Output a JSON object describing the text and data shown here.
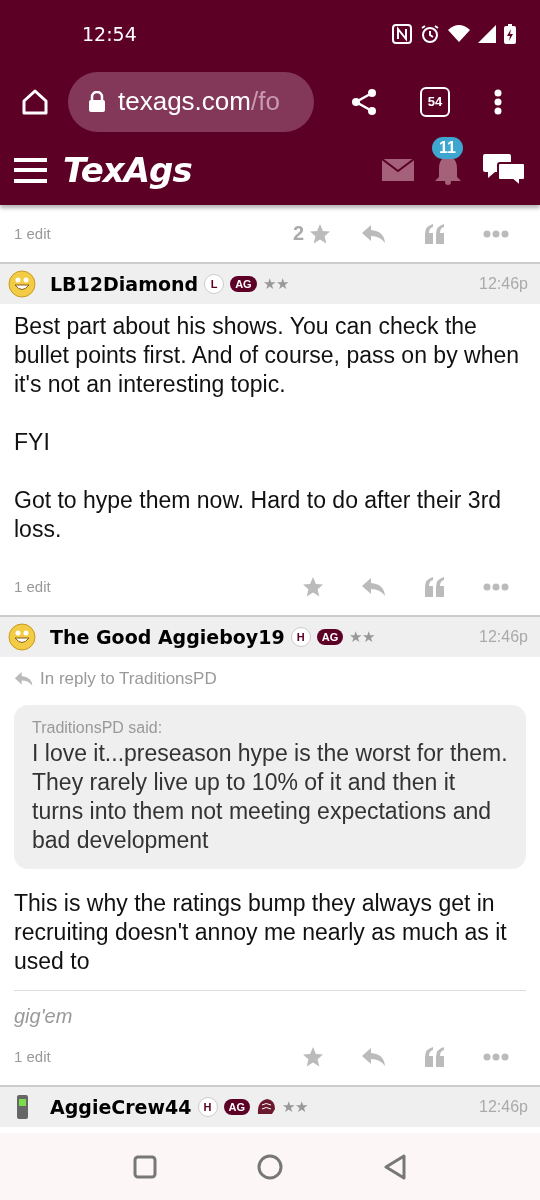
{
  "status_bar": {
    "time": "12:54"
  },
  "browser": {
    "url_host": "texags.com",
    "url_path": "/fo",
    "tab_count": "54"
  },
  "app_header": {
    "logo": "TexAgs",
    "notification_count": "11"
  },
  "posts": [
    {
      "footer": {
        "edits": "1 edit",
        "star_count": "2"
      }
    },
    {
      "author": "LB12Diamond",
      "avatar": {
        "kind": "smiley"
      },
      "badges": [
        {
          "kind": "status",
          "label": "L"
        },
        {
          "kind": "school",
          "label": "AG"
        }
      ],
      "rank": "★★",
      "time": "12:46p",
      "paragraphs": [
        "Best part about his shows. You can check the bullet points first. And of course, pass on by when it's not an interesting topic.",
        "FYI",
        "Got to hype them now. Hard to do after their 3rd loss."
      ],
      "footer": {
        "edits": "1 edit"
      }
    },
    {
      "author": "The Good Aggieboy19",
      "avatar": {
        "kind": "smiley"
      },
      "badges": [
        {
          "kind": "status",
          "label": "H"
        },
        {
          "kind": "school",
          "label": "AG"
        }
      ],
      "rank": "★★",
      "time": "12:46p",
      "reply_to": "In reply to TraditionsPD",
      "quote": {
        "attribution": "TraditionsPD said:",
        "text": "I love it...preseason hype is the worst for them. They rarely live up to 10% of it and then it turns into them not meeting expectations and bad development"
      },
      "paragraphs": [
        "This is why the ratings bump they always get in recruiting doesn't annoy me nearly as much as it used to"
      ],
      "signature": "gig'em",
      "footer": {
        "edits": "1 edit"
      }
    },
    {
      "author": "AggieCrew44",
      "avatar": {
        "kind": "phone"
      },
      "badges": [
        {
          "kind": "status",
          "label": "H"
        },
        {
          "kind": "school",
          "label": "AG"
        },
        {
          "kind": "mascot"
        }
      ],
      "rank": "★★",
      "time": "12:46p"
    }
  ]
}
